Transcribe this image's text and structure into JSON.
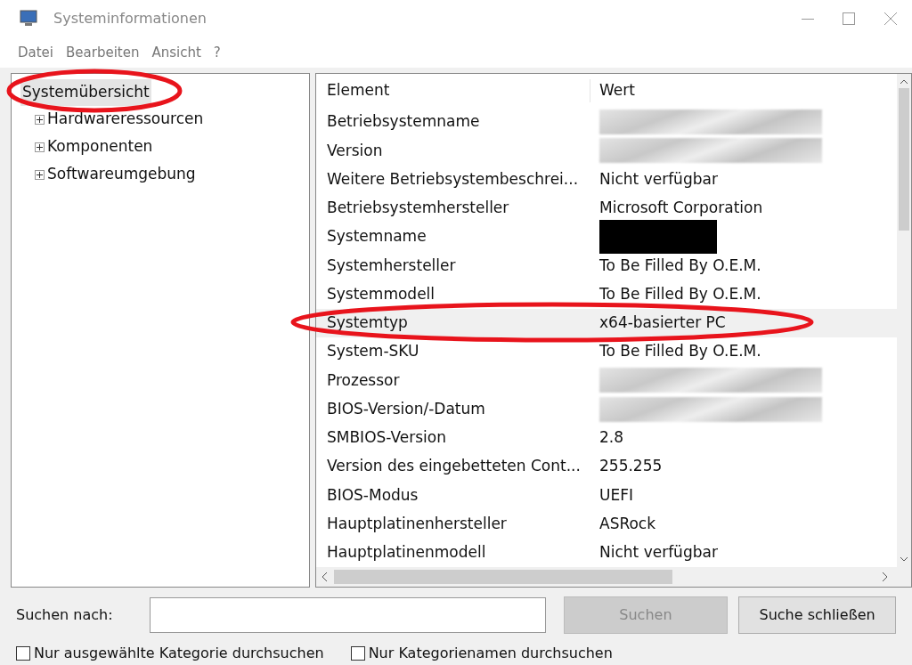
{
  "window": {
    "title": "Systeminformationen"
  },
  "menu": [
    "Datei",
    "Bearbeiten",
    "Ansicht",
    "?"
  ],
  "tree": [
    {
      "label": "Systemübersicht",
      "selected": true,
      "children": [
        {
          "label": "Hardwareressourcen",
          "selected": false,
          "expanded": false
        },
        {
          "label": "Komponenten",
          "selected": false,
          "expanded": false
        },
        {
          "label": "Softwareumgebung",
          "selected": false,
          "expanded": false
        }
      ]
    }
  ],
  "table": {
    "columns": [
      "Element",
      "Wert"
    ],
    "rows": [
      {
        "element": "Betriebsystemname",
        "kind": "blurred",
        "selected": false
      },
      {
        "element": "Version",
        "kind": "blurred",
        "selected": false
      },
      {
        "element": "Weitere Betriebsystembeschrei...",
        "kind": "text",
        "value": "Nicht verfügbar",
        "selected": false
      },
      {
        "element": "Betriebsystemhersteller",
        "kind": "text",
        "value": "Microsoft Corporation",
        "selected": false
      },
      {
        "element": "Systemname",
        "kind": "blacked",
        "selected": false
      },
      {
        "element": "Systemhersteller",
        "kind": "text",
        "value": "To Be Filled By O.E.M.",
        "selected": false
      },
      {
        "element": "Systemmodell",
        "kind": "text",
        "value": "To Be Filled By O.E.M.",
        "selected": false
      },
      {
        "element": "Systemtyp",
        "kind": "text",
        "value": "x64-basierter PC",
        "selected": true
      },
      {
        "element": "System-SKU",
        "kind": "text",
        "value": "To Be Filled By O.E.M.",
        "selected": false
      },
      {
        "element": "Prozessor",
        "kind": "blurred",
        "selected": false
      },
      {
        "element": "BIOS-Version/-Datum",
        "kind": "blurred",
        "selected": false
      },
      {
        "element": "SMBIOS-Version",
        "kind": "text",
        "value": "2.8",
        "selected": false
      },
      {
        "element": "Version des eingebetteten Cont...",
        "kind": "text",
        "value": "255.255",
        "selected": false
      },
      {
        "element": "BIOS-Modus",
        "kind": "text",
        "value": "UEFI",
        "selected": false
      },
      {
        "element": "Hauptplatinenhersteller",
        "kind": "text",
        "value": "ASRock",
        "selected": false
      },
      {
        "element": "Hauptplatinenmodell",
        "kind": "text",
        "value": "Nicht verfügbar",
        "selected": false
      }
    ]
  },
  "search": {
    "label": "Suchen nach:",
    "search_button": {
      "label": "Suchen",
      "disabled": true
    },
    "close_button": "Suche schließen"
  },
  "options": [
    {
      "label": "Nur ausgewählte Kategorie durchsuchen",
      "checked": false
    },
    {
      "label": "Nur Kategorienamen durchsuchen",
      "checked": false
    }
  ]
}
